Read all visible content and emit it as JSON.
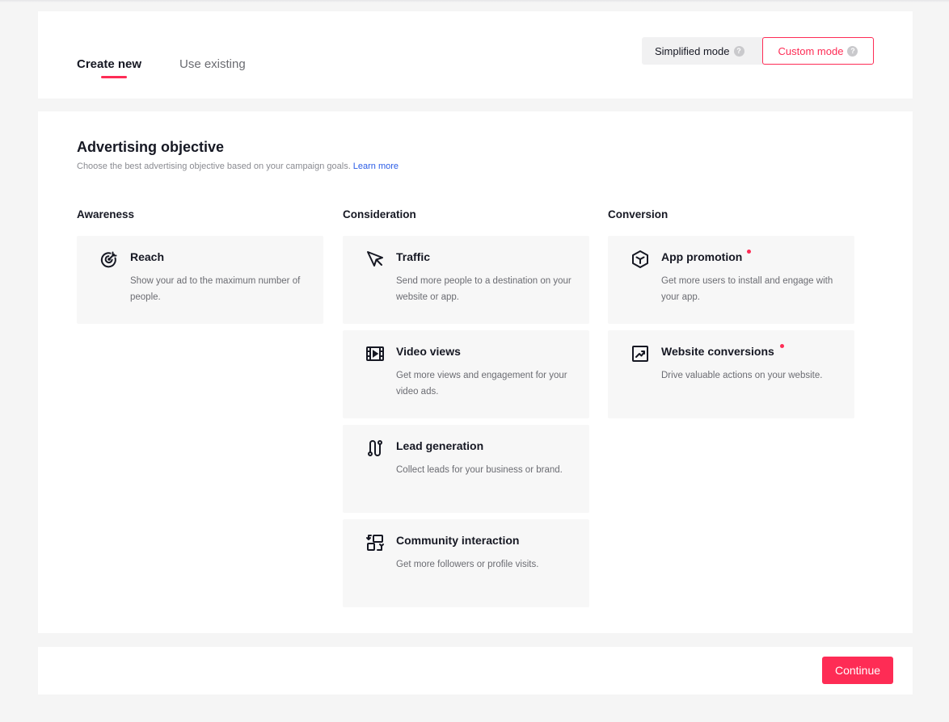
{
  "tabs": {
    "create_new": "Create new",
    "use_existing": "Use existing"
  },
  "mode": {
    "simplified": "Simplified mode",
    "custom": "Custom mode",
    "selected": "Custom mode"
  },
  "objective": {
    "title": "Advertising objective",
    "subtitle": "Choose the best advertising objective based on your campaign goals.",
    "learn_more": "Learn more"
  },
  "columns": {
    "awareness": {
      "heading": "Awareness",
      "items": [
        {
          "title": "Reach",
          "desc": "Show your ad to the maximum number of people.",
          "icon": "reach-icon"
        }
      ]
    },
    "consideration": {
      "heading": "Consideration",
      "items": [
        {
          "title": "Traffic",
          "desc": "Send more people to a destination on your website or app.",
          "icon": "cursor-icon"
        },
        {
          "title": "Video views",
          "desc": "Get more views and engagement for your video ads.",
          "icon": "video-icon"
        },
        {
          "title": "Lead generation",
          "desc": "Collect leads for your business or brand.",
          "icon": "lead-icon"
        },
        {
          "title": "Community interaction",
          "desc": "Get more followers or profile visits.",
          "icon": "community-icon"
        }
      ]
    },
    "conversion": {
      "heading": "Conversion",
      "items": [
        {
          "title": "App promotion",
          "desc": "Get more users to install and engage with your app.",
          "icon": "cube-icon"
        },
        {
          "title": "Website conversions",
          "desc": "Drive valuable actions on your website.",
          "icon": "trend-icon"
        }
      ]
    }
  },
  "footer": {
    "continue": "Continue"
  },
  "colors": {
    "accent": "#fe2c55",
    "link": "#2b5ce6",
    "card_bg": "#f7f7f7",
    "page_bg": "#f5f5f5"
  }
}
